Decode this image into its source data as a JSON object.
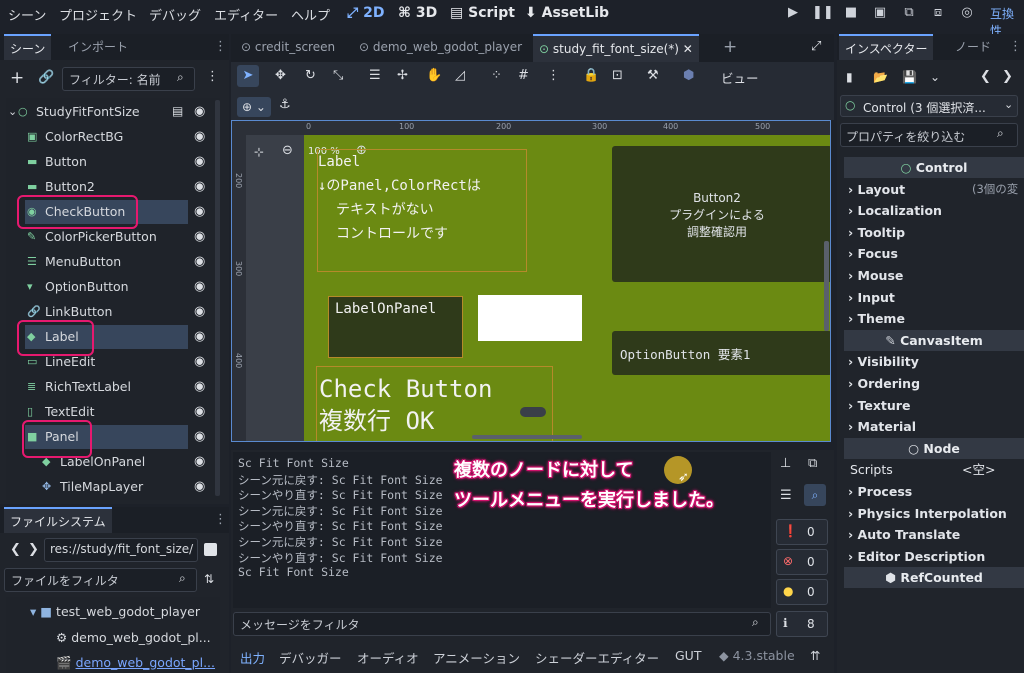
{
  "menu": [
    "シーン",
    "プロジェクト",
    "デバッグ",
    "エディター",
    "ヘルプ"
  ],
  "workspaces": [
    "2D",
    "3D",
    "Script",
    "AssetLib"
  ],
  "compat_label": "互換性",
  "scene_dock": {
    "tabs": [
      "シーン",
      "インポート"
    ],
    "filter_placeholder": "フィルター: 名前",
    "nodes": [
      {
        "label": "StudyFitFontSize"
      },
      {
        "label": "ColorRectBG"
      },
      {
        "label": "Button"
      },
      {
        "label": "Button2"
      },
      {
        "label": "CheckButton"
      },
      {
        "label": "ColorPickerButton"
      },
      {
        "label": "MenuButton"
      },
      {
        "label": "OptionButton"
      },
      {
        "label": "LinkButton"
      },
      {
        "label": "Label"
      },
      {
        "label": "LineEdit"
      },
      {
        "label": "RichTextLabel"
      },
      {
        "label": "TextEdit"
      },
      {
        "label": "Panel"
      },
      {
        "label": "LabelOnPanel"
      },
      {
        "label": "TileMapLayer"
      }
    ]
  },
  "filesystem": {
    "tab": "ファイルシステム",
    "path": "res://study/fit_font_size/",
    "filter_placeholder": "ファイルをフィルタ",
    "items": [
      "test_web_godot_player",
      "demo_web_godot_pl...",
      "demo_web_godot_pl..."
    ]
  },
  "editor_tabs": [
    "credit_screen",
    "demo_web_godot_player",
    "study_fit_font_size(*)"
  ],
  "toolbar": {
    "view_label": "ビュー"
  },
  "viewport": {
    "zoom": "100 %",
    "ruler_top": [
      "0",
      "100",
      "200",
      "300",
      "400",
      "500"
    ],
    "ruler_left": [
      "200",
      "300",
      "400"
    ],
    "label_text": [
      "Label",
      "↓のPanel,ColorRectは",
      "テキストがない",
      "コントロールです"
    ],
    "button2_text": [
      "Button2",
      "プラグインによる",
      "調整確認用"
    ],
    "label_on_panel": "LabelOnPanel",
    "option_button": "OptionButton 要素1",
    "check_button": [
      "Check Button",
      "複数行 OK"
    ]
  },
  "output": {
    "lines": [
      "Sc Fit Font Size",
      "シーン元に戻す: Sc Fit Font Size",
      "シーンやり直す: Sc Fit Font Size",
      "シーン元に戻す: Sc Fit Font Size",
      "シーンやり直す: Sc Fit Font Size",
      "シーン元に戻す: Sc Fit Font Size",
      "シーンやり直す: Sc Fit Font Size",
      "Sc Fit Font Size"
    ],
    "filter_placeholder": "メッセージをフィルタ",
    "counts": {
      "messages": "0",
      "errors": "0",
      "warnings": "0",
      "info": "8"
    }
  },
  "annotation": [
    "複数のノードに対して",
    "ツールメニューを実行しました。"
  ],
  "bottom_tabs": [
    "出力",
    "デバッガー",
    "オーディオ",
    "アニメーション",
    "シェーダーエディター",
    "GUT"
  ],
  "version": "4.3.stable",
  "inspector": {
    "tabs": [
      "インスペクター",
      "ノード"
    ],
    "node_select": "Control (3 個選択済...",
    "filter_placeholder": "プロパティを絞り込む",
    "sections": [
      {
        "type": "head",
        "label": "Control"
      },
      {
        "type": "sec",
        "label": "Layout",
        "extra": "(3個の変"
      },
      {
        "type": "sec",
        "label": "Localization"
      },
      {
        "type": "sec",
        "label": "Tooltip"
      },
      {
        "type": "sec",
        "label": "Focus"
      },
      {
        "type": "sec",
        "label": "Mouse"
      },
      {
        "type": "sec",
        "label": "Input"
      },
      {
        "type": "sec",
        "label": "Theme"
      },
      {
        "type": "head",
        "label": "CanvasItem"
      },
      {
        "type": "sec",
        "label": "Visibility"
      },
      {
        "type": "sec",
        "label": "Ordering"
      },
      {
        "type": "sec",
        "label": "Texture"
      },
      {
        "type": "sec",
        "label": "Material"
      },
      {
        "type": "head",
        "label": "Node"
      },
      {
        "type": "prop",
        "label": "Scripts",
        "value": "<空>"
      },
      {
        "type": "sec",
        "label": "Process"
      },
      {
        "type": "sec",
        "label": "Physics Interpolation"
      },
      {
        "type": "sec",
        "label": "Auto Translate"
      },
      {
        "type": "sec",
        "label": "Editor Description"
      },
      {
        "type": "head",
        "label": "RefCounted"
      }
    ]
  },
  "colors": {
    "accent": "#6aa3ff",
    "highlight": "#e6196f",
    "canvas": "#6b8a12",
    "annotation_text": "#ffffff"
  }
}
